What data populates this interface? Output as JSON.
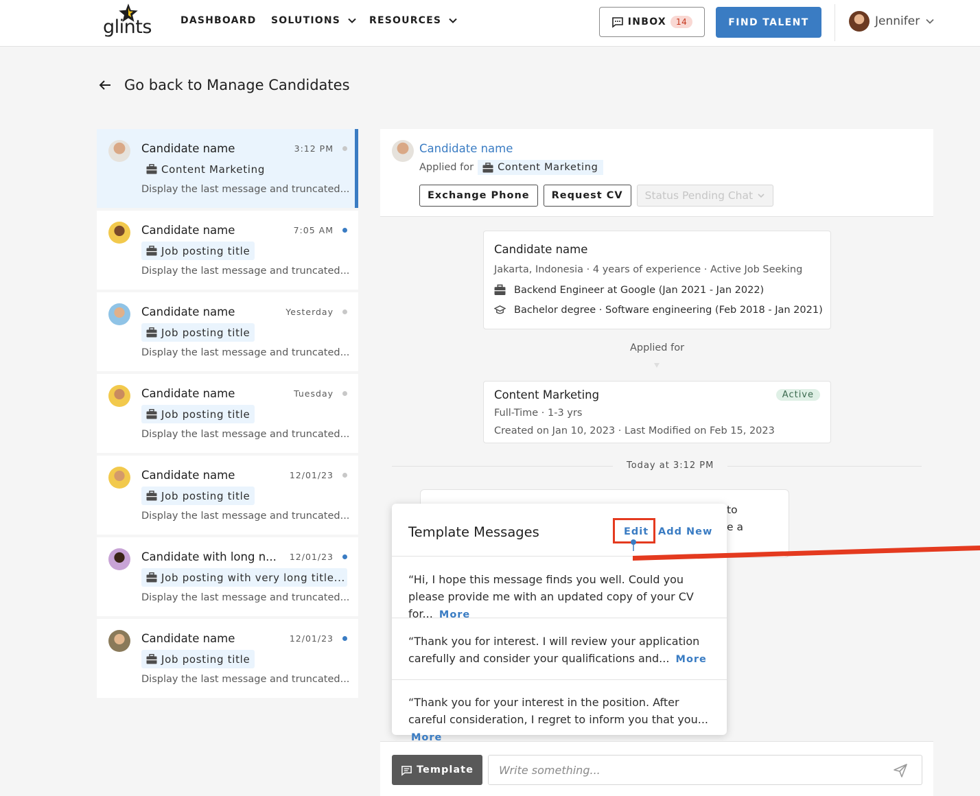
{
  "nav": {
    "logo": "glints",
    "items": [
      {
        "label": "DASHBOARD"
      },
      {
        "label": "SOLUTIONS"
      },
      {
        "label": "RESOURCES"
      }
    ],
    "inbox_label": "INBOX",
    "inbox_count": "14",
    "find_talent_label": "FIND TALENT",
    "user_name": "Jennifer"
  },
  "back_link": "Go back to Manage Candidates",
  "candidates": [
    {
      "name": "Candidate name",
      "time": "3:12 PM",
      "job": "Content Marketing",
      "last_message": "Display the last message and truncated...",
      "unread": false,
      "active": true
    },
    {
      "name": "Candidate name",
      "time": "7:05 AM",
      "job": "Job posting title",
      "last_message": "Display the last message and truncated...",
      "unread": true,
      "active": false
    },
    {
      "name": "Candidate name",
      "time": "Yesterday",
      "job": "Job posting title",
      "last_message": "Display the last message and truncated...",
      "unread": false,
      "active": false
    },
    {
      "name": "Candidate name",
      "time": "Tuesday",
      "job": "Job posting title",
      "last_message": "Display the last message and truncated...",
      "unread": false,
      "active": false
    },
    {
      "name": "Candidate name",
      "time": "12/01/23",
      "job": "Job posting title",
      "last_message": "Display the last message and truncated...",
      "unread": false,
      "active": false
    },
    {
      "name": "Candidate with long n...",
      "time": "12/01/23",
      "job": "Job posting with very long title...",
      "last_message": "Display the last message and truncated...",
      "unread": true,
      "active": false
    },
    {
      "name": "Candidate name",
      "time": "12/01/23",
      "job": "Job posting title",
      "last_message": "Display the last message and truncated...",
      "unread": true,
      "active": false
    }
  ],
  "chat": {
    "candidate_name": "Candidate name",
    "applied_for_label": "Applied for",
    "applied_job": "Content Marketing",
    "actions": {
      "exchange_phone": "Exchange Phone",
      "request_cv": "Request CV",
      "status": "Status Pending Chat"
    },
    "profile": {
      "name": "Candidate name",
      "meta": "Jakarta, Indonesia ·  4 years of experience ·  Active Job Seeking",
      "experience": "Backend Engineer at Google (Jan 2021 - Jan 2022)",
      "education": "Bachelor degree · Software engineering (Feb 2018 - Jan 2021)"
    },
    "applied_for_divider": "Applied for",
    "job": {
      "title": "Content Marketing",
      "status": "Active",
      "type": "Full-Time · 1-3 yrs",
      "dates": "Created on Jan 10, 2023 · Last Modified on Feb 15, 2023"
    },
    "day_separator": "Today at 3:12 PM",
    "bubble_visible_text": "to\ne a"
  },
  "templates": {
    "title": "Template Messages",
    "edit_label": "Edit",
    "add_new_label": "Add New",
    "more_label": "More",
    "items": [
      {
        "text": "“Hi, I hope this message finds you well. Could you please provide me with an updated copy of your CV for..."
      },
      {
        "text": "“Thank you for interest. I will review your application carefully and consider your qualifications and..."
      },
      {
        "text": "“Thank you for your interest in the position. After careful consideration, I regret to inform you that you..."
      }
    ]
  },
  "composer": {
    "template_button": "Template",
    "placeholder": "Write something..."
  },
  "colors": {
    "brand_blue": "#3a7cc3",
    "annotation_red": "#e43a1f"
  }
}
